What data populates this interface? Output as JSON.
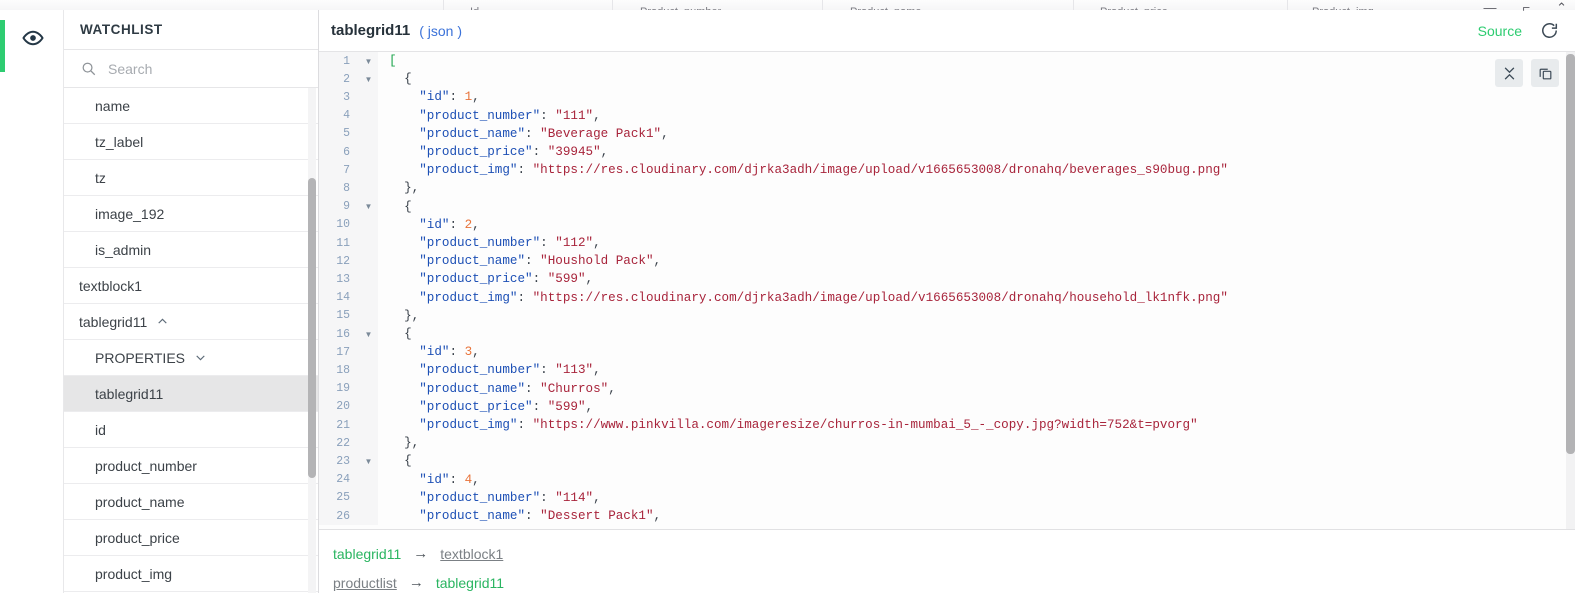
{
  "window": {
    "controls": [
      "—",
      "⌐",
      "⌃"
    ],
    "background_headers": [
      "Id",
      "Product_number",
      "Product_name",
      "Product_price",
      "Product_img"
    ]
  },
  "rail": {
    "eye_icon": "eye-icon",
    "accent_color": "#2ecc71"
  },
  "sidebar": {
    "title": "WATCHLIST",
    "search": {
      "placeholder": "Search",
      "value": "",
      "icon": "search-icon"
    },
    "items": [
      {
        "label": "name",
        "indent": 2,
        "selected": false,
        "caret": ""
      },
      {
        "label": "tz_label",
        "indent": 2,
        "selected": false,
        "caret": ""
      },
      {
        "label": "tz",
        "indent": 2,
        "selected": false,
        "caret": ""
      },
      {
        "label": "image_192",
        "indent": 2,
        "selected": false,
        "caret": ""
      },
      {
        "label": "is_admin",
        "indent": 2,
        "selected": false,
        "caret": ""
      },
      {
        "label": "textblock1",
        "indent": 1,
        "selected": false,
        "caret": ""
      },
      {
        "label": "tablegrid11",
        "indent": 1,
        "selected": false,
        "caret": "up"
      },
      {
        "label": "PROPERTIES",
        "indent": 2,
        "selected": false,
        "caret": "down"
      },
      {
        "label": "tablegrid11",
        "indent": 2,
        "selected": true,
        "caret": ""
      },
      {
        "label": "id",
        "indent": 2,
        "selected": false,
        "caret": ""
      },
      {
        "label": "product_number",
        "indent": 2,
        "selected": false,
        "caret": ""
      },
      {
        "label": "product_name",
        "indent": 2,
        "selected": false,
        "caret": ""
      },
      {
        "label": "product_price",
        "indent": 2,
        "selected": false,
        "caret": ""
      },
      {
        "label": "product_img",
        "indent": 2,
        "selected": false,
        "caret": ""
      }
    ]
  },
  "main": {
    "title": "tablegrid11",
    "type": "( json )",
    "source_label": "Source",
    "refresh_icon": "refresh-icon",
    "collapse_icon": "collapse-all-icon",
    "copy_icon": "copy-icon"
  },
  "code": {
    "language": "json",
    "lines": [
      {
        "n": 1,
        "fold": "down",
        "tokens": [
          {
            "t": "[",
            "c": "b"
          }
        ]
      },
      {
        "n": 2,
        "fold": "down",
        "tokens": [
          {
            "t": "  {",
            "c": "p"
          }
        ]
      },
      {
        "n": 3,
        "fold": "",
        "tokens": [
          {
            "t": "    ",
            "c": "p"
          },
          {
            "t": "\"id\"",
            "c": "k"
          },
          {
            "t": ": ",
            "c": "p"
          },
          {
            "t": "1",
            "c": "n"
          },
          {
            "t": ",",
            "c": "p"
          }
        ]
      },
      {
        "n": 4,
        "fold": "",
        "tokens": [
          {
            "t": "    ",
            "c": "p"
          },
          {
            "t": "\"product_number\"",
            "c": "k"
          },
          {
            "t": ": ",
            "c": "p"
          },
          {
            "t": "\"111\"",
            "c": "s"
          },
          {
            "t": ",",
            "c": "p"
          }
        ]
      },
      {
        "n": 5,
        "fold": "",
        "tokens": [
          {
            "t": "    ",
            "c": "p"
          },
          {
            "t": "\"product_name\"",
            "c": "k"
          },
          {
            "t": ": ",
            "c": "p"
          },
          {
            "t": "\"Beverage Pack1\"",
            "c": "s"
          },
          {
            "t": ",",
            "c": "p"
          }
        ]
      },
      {
        "n": 6,
        "fold": "",
        "tokens": [
          {
            "t": "    ",
            "c": "p"
          },
          {
            "t": "\"product_price\"",
            "c": "k"
          },
          {
            "t": ": ",
            "c": "p"
          },
          {
            "t": "\"39945\"",
            "c": "s"
          },
          {
            "t": ",",
            "c": "p"
          }
        ]
      },
      {
        "n": 7,
        "fold": "",
        "tokens": [
          {
            "t": "    ",
            "c": "p"
          },
          {
            "t": "\"product_img\"",
            "c": "k"
          },
          {
            "t": ": ",
            "c": "p"
          },
          {
            "t": "\"https://res.cloudinary.com/djrka3adh/image/upload/v1665653008/dronahq/beverages_s90bug.png\"",
            "c": "s"
          }
        ]
      },
      {
        "n": 8,
        "fold": "",
        "tokens": [
          {
            "t": "  },",
            "c": "p"
          }
        ]
      },
      {
        "n": 9,
        "fold": "down",
        "tokens": [
          {
            "t": "  {",
            "c": "p"
          }
        ]
      },
      {
        "n": 10,
        "fold": "",
        "tokens": [
          {
            "t": "    ",
            "c": "p"
          },
          {
            "t": "\"id\"",
            "c": "k"
          },
          {
            "t": ": ",
            "c": "p"
          },
          {
            "t": "2",
            "c": "n"
          },
          {
            "t": ",",
            "c": "p"
          }
        ]
      },
      {
        "n": 11,
        "fold": "",
        "tokens": [
          {
            "t": "    ",
            "c": "p"
          },
          {
            "t": "\"product_number\"",
            "c": "k"
          },
          {
            "t": ": ",
            "c": "p"
          },
          {
            "t": "\"112\"",
            "c": "s"
          },
          {
            "t": ",",
            "c": "p"
          }
        ]
      },
      {
        "n": 12,
        "fold": "",
        "tokens": [
          {
            "t": "    ",
            "c": "p"
          },
          {
            "t": "\"product_name\"",
            "c": "k"
          },
          {
            "t": ": ",
            "c": "p"
          },
          {
            "t": "\"Houshold Pack\"",
            "c": "s"
          },
          {
            "t": ",",
            "c": "p"
          }
        ]
      },
      {
        "n": 13,
        "fold": "",
        "tokens": [
          {
            "t": "    ",
            "c": "p"
          },
          {
            "t": "\"product_price\"",
            "c": "k"
          },
          {
            "t": ": ",
            "c": "p"
          },
          {
            "t": "\"599\"",
            "c": "s"
          },
          {
            "t": ",",
            "c": "p"
          }
        ]
      },
      {
        "n": 14,
        "fold": "",
        "tokens": [
          {
            "t": "    ",
            "c": "p"
          },
          {
            "t": "\"product_img\"",
            "c": "k"
          },
          {
            "t": ": ",
            "c": "p"
          },
          {
            "t": "\"https://res.cloudinary.com/djrka3adh/image/upload/v1665653008/dronahq/household_lk1nfk.png\"",
            "c": "s"
          }
        ]
      },
      {
        "n": 15,
        "fold": "",
        "tokens": [
          {
            "t": "  },",
            "c": "p"
          }
        ]
      },
      {
        "n": 16,
        "fold": "down",
        "tokens": [
          {
            "t": "  {",
            "c": "p"
          }
        ]
      },
      {
        "n": 17,
        "fold": "",
        "tokens": [
          {
            "t": "    ",
            "c": "p"
          },
          {
            "t": "\"id\"",
            "c": "k"
          },
          {
            "t": ": ",
            "c": "p"
          },
          {
            "t": "3",
            "c": "n"
          },
          {
            "t": ",",
            "c": "p"
          }
        ]
      },
      {
        "n": 18,
        "fold": "",
        "tokens": [
          {
            "t": "    ",
            "c": "p"
          },
          {
            "t": "\"product_number\"",
            "c": "k"
          },
          {
            "t": ": ",
            "c": "p"
          },
          {
            "t": "\"113\"",
            "c": "s"
          },
          {
            "t": ",",
            "c": "p"
          }
        ]
      },
      {
        "n": 19,
        "fold": "",
        "tokens": [
          {
            "t": "    ",
            "c": "p"
          },
          {
            "t": "\"product_name\"",
            "c": "k"
          },
          {
            "t": ": ",
            "c": "p"
          },
          {
            "t": "\"Churros\"",
            "c": "s"
          },
          {
            "t": ",",
            "c": "p"
          }
        ]
      },
      {
        "n": 20,
        "fold": "",
        "tokens": [
          {
            "t": "    ",
            "c": "p"
          },
          {
            "t": "\"product_price\"",
            "c": "k"
          },
          {
            "t": ": ",
            "c": "p"
          },
          {
            "t": "\"599\"",
            "c": "s"
          },
          {
            "t": ",",
            "c": "p"
          }
        ]
      },
      {
        "n": 21,
        "fold": "",
        "tokens": [
          {
            "t": "    ",
            "c": "p"
          },
          {
            "t": "\"product_img\"",
            "c": "k"
          },
          {
            "t": ": ",
            "c": "p"
          },
          {
            "t": "\"https://www.pinkvilla.com/imageresize/churros-in-mumbai_5_-_copy.jpg?width=752&t=pvorg\"",
            "c": "s"
          }
        ]
      },
      {
        "n": 22,
        "fold": "",
        "tokens": [
          {
            "t": "  },",
            "c": "p"
          }
        ]
      },
      {
        "n": 23,
        "fold": "down",
        "tokens": [
          {
            "t": "  {",
            "c": "p"
          }
        ]
      },
      {
        "n": 24,
        "fold": "",
        "tokens": [
          {
            "t": "    ",
            "c": "p"
          },
          {
            "t": "\"id\"",
            "c": "k"
          },
          {
            "t": ": ",
            "c": "p"
          },
          {
            "t": "4",
            "c": "n"
          },
          {
            "t": ",",
            "c": "p"
          }
        ]
      },
      {
        "n": 25,
        "fold": "",
        "tokens": [
          {
            "t": "    ",
            "c": "p"
          },
          {
            "t": "\"product_number\"",
            "c": "k"
          },
          {
            "t": ": ",
            "c": "p"
          },
          {
            "t": "\"114\"",
            "c": "s"
          },
          {
            "t": ",",
            "c": "p"
          }
        ]
      },
      {
        "n": 26,
        "fold": "",
        "tokens": [
          {
            "t": "    ",
            "c": "p"
          },
          {
            "t": "\"product_name\"",
            "c": "k"
          },
          {
            "t": ": ",
            "c": "p"
          },
          {
            "t": "\"Dessert Pack1\"",
            "c": "s"
          },
          {
            "t": ",",
            "c": "p"
          }
        ]
      }
    ]
  },
  "relations": [
    {
      "from": "tablegrid11",
      "from_style": "green",
      "arrow": "→",
      "to": "textblock1",
      "to_style": "gray"
    },
    {
      "from": "productlist",
      "from_style": "gray",
      "arrow": "→",
      "to": "tablegrid11",
      "to_style": "green"
    }
  ]
}
